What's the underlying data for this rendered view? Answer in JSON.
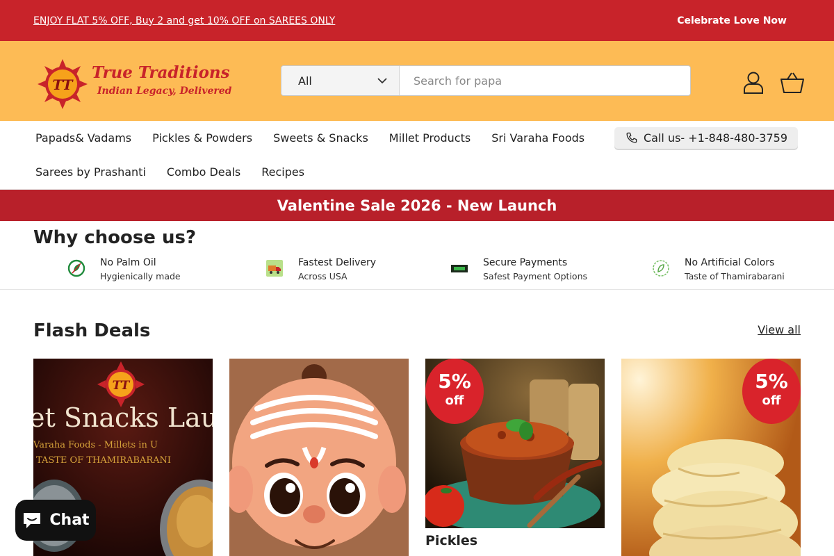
{
  "announcement": {
    "left_text": "ENJOY FLAT 5% OFF, Buy 2 and get 10% OFF on SAREES ONLY",
    "right_text": "Celebrate Love Now"
  },
  "logo": {
    "title": "True Traditions",
    "subtitle": "Indian Legacy, Delivered",
    "emblem_text": "TT"
  },
  "search": {
    "category": "All",
    "placeholder": "Search for papa"
  },
  "nav": {
    "row1": [
      "Papads& Vadams",
      "Pickles & Powders",
      "Sweets & Snacks",
      "Millet Products",
      "Sri Varaha Foods"
    ],
    "row2": [
      "Sarees by Prashanti",
      "Combo Deals",
      "Recipes"
    ],
    "call": "Call us- +1-848-480-3759"
  },
  "sale_banner": "Valentine Sale 2026 - New Launch",
  "why": {
    "title": "Why choose us?",
    "features": [
      {
        "title": "No Palm Oil",
        "subtitle": "Hygienically made",
        "icon": "leaf-icon"
      },
      {
        "title": "Fastest Delivery",
        "subtitle": "Across USA",
        "icon": "delivery-truck-icon"
      },
      {
        "title": "Secure Payments",
        "subtitle": "Safest Payment Options",
        "icon": "card-icon"
      },
      {
        "title": "No Artificial Colors",
        "subtitle": "Taste of Thamirabarani",
        "icon": "natural-icon"
      }
    ]
  },
  "flash": {
    "title": "Flash Deals",
    "view_all": "View all",
    "card1": {
      "image_lines": [
        "et Snacks Lau",
        "Varaha Foods - Millets in U",
        "TASTE OF THAMIRABARANI"
      ],
      "emblem_text": "TT"
    },
    "card3": {
      "badge_pct": "5%",
      "badge_off": "off",
      "title": "Pickles"
    },
    "card4": {
      "badge_pct": "5%",
      "badge_off": "off"
    }
  },
  "chat": {
    "label": "Chat"
  },
  "colors": {
    "brand_red": "#c8232a",
    "header_yellow": "#fdbb55",
    "badge_red": "#d9232b"
  }
}
